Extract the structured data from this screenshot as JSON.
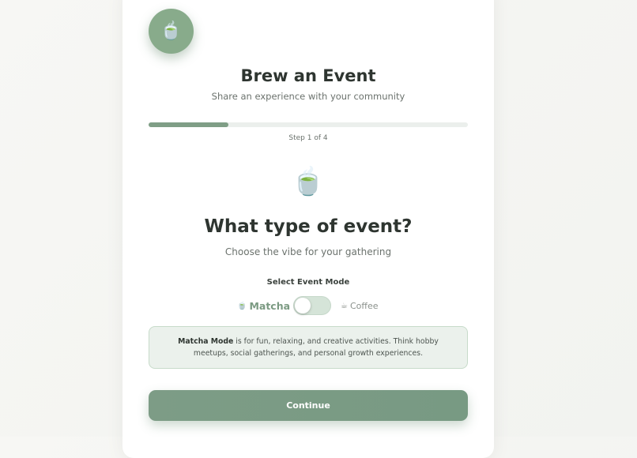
{
  "header": {
    "logo_icon": "🍵",
    "title": "Brew an Event",
    "subtitle": "Share an experience with your community"
  },
  "progress": {
    "fraction": 0.25,
    "label": "Step 1 of 4"
  },
  "question": {
    "icon": "🍵",
    "title": "What type of event?",
    "subtitle": "Choose the vibe for your gathering"
  },
  "mode_selector": {
    "label": "Select Event Mode",
    "matcha_icon": "🍵",
    "matcha_label": "Matcha",
    "coffee_icon": "☕",
    "coffee_label": "Coffee",
    "selected": "Matcha"
  },
  "info": {
    "bold": "Matcha Mode",
    "text": " is for fun, relaxing, and creative activities. Think hobby meetups, social gatherings, and personal growth experiences."
  },
  "footer": {
    "continue_label": "Continue"
  },
  "colors": {
    "accent": "#7f9e86",
    "logo_bg": "#88ab8b",
    "info_bg": "#ebf1ec"
  }
}
